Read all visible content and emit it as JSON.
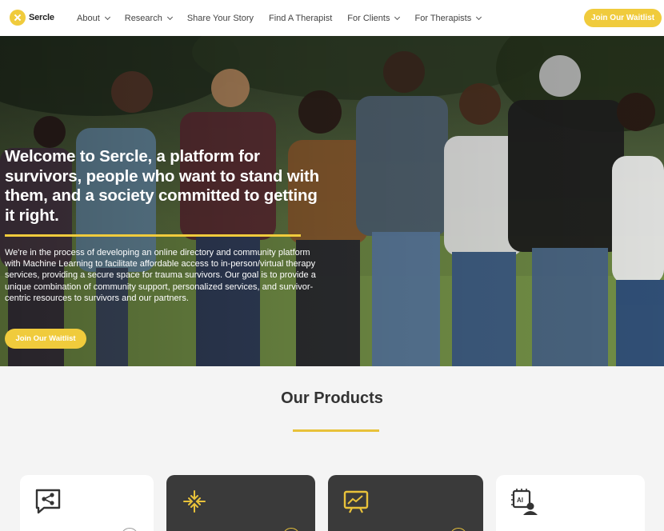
{
  "brand": {
    "name": "Sercle",
    "accent": "#f0cb3c"
  },
  "nav": {
    "items": [
      {
        "label": "About",
        "dropdown": true
      },
      {
        "label": "Research",
        "dropdown": true
      },
      {
        "label": "Share Your Story",
        "dropdown": false
      },
      {
        "label": "Find A Therapist",
        "dropdown": false
      },
      {
        "label": "For Clients",
        "dropdown": true
      },
      {
        "label": "For Therapists",
        "dropdown": true
      }
    ],
    "cta": "Join Our Waitlist"
  },
  "hero": {
    "title": "Welcome to Sercle, a platform for survivors, people who want to stand with them, and a society committed to getting it right.",
    "description": "We're in the process of developing an online directory and community platform with Machine Learning to facilitate affordable access to in-person/virtual therapy services, providing a secure space for trauma survivors. Our goal is to provide a unique combination of community support, personalized services, and survivor-centric resources to survivors and our partners.",
    "cta": "Join Our Waitlist"
  },
  "products": {
    "title": "Our Products",
    "cards": [
      {
        "icon": "chat-share-icon",
        "theme": "light"
      },
      {
        "icon": "arrows-converge-icon",
        "theme": "dark"
      },
      {
        "icon": "presentation-chart-icon",
        "theme": "dark"
      },
      {
        "icon": "ai-chip-user-icon",
        "theme": "light"
      }
    ]
  }
}
